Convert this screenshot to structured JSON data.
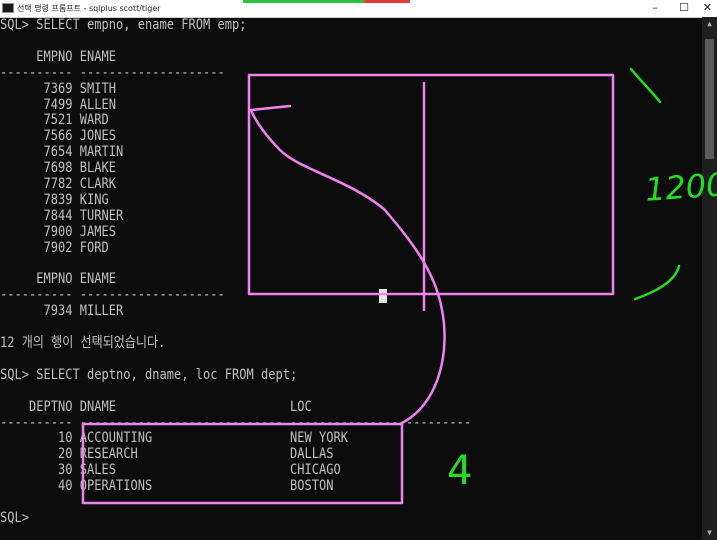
{
  "window": {
    "title": "선택 명령 프롬프트 - sqlplus  scott/tiger",
    "minimize_icon": "minimize-icon",
    "maximize_icon": "maximize-icon",
    "close_icon": "close-icon"
  },
  "console": {
    "lines": [
      "SQL> SELECT empno, ename FROM emp;",
      "",
      "     EMPNO ENAME",
      "---------- --------------------",
      "      7369 SMITH",
      "      7499 ALLEN",
      "      7521 WARD",
      "      7566 JONES",
      "      7654 MARTIN",
      "      7698 BLAKE",
      "      7782 CLARK",
      "      7839 KING",
      "      7844 TURNER",
      "      7900 JAMES",
      "      7902 FORD",
      "",
      "     EMPNO ENAME",
      "---------- --------------------",
      "      7934 MILLER",
      "",
      "12 개의 행이 선택되었습니다.",
      "",
      "SQL> SELECT deptno, dname, loc FROM dept;",
      "",
      "    DEPTNO DNAME                        LOC",
      "---------- ---------------------------- -------------------------",
      "        10 ACCOUNTING                   NEW YORK",
      "        20 RESEARCH                     DALLAS",
      "        30 SALES                        CHICAGO",
      "        40 OPERATIONS                   BOSTON",
      "",
      "SQL>"
    ]
  },
  "annotations": {
    "number_1200": "1200",
    "number_4": "4"
  },
  "colors": {
    "background": "#0c0c0c",
    "text": "#c0c0c0",
    "pink_annotation": "#ee82ee",
    "green_annotation": "#22dd22"
  }
}
